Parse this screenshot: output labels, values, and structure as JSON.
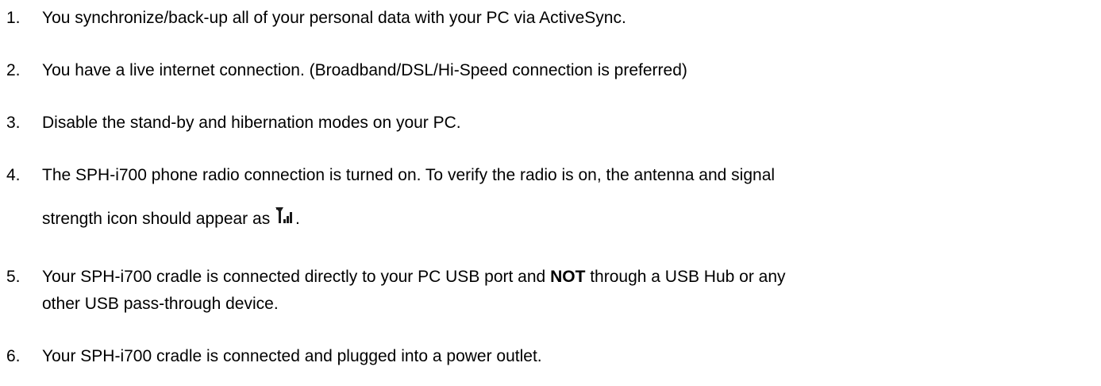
{
  "items": [
    {
      "num": "1.",
      "text": "You synchronize/back-up all of your personal data with your PC via ActiveSync."
    },
    {
      "num": "2.",
      "text": "You have a live internet connection. (Broadband/DSL/Hi-Speed connection is preferred)"
    },
    {
      "num": "3.",
      "text": "Disable the stand-by and hibernation modes on your PC."
    },
    {
      "num": "4.",
      "line1": "The SPH-i700 phone radio connection is turned on. To verify the radio is on, the antenna and signal",
      "line2_before": "strength icon should appear as",
      "line2_after": ".",
      "icon": "antenna-signal-icon"
    },
    {
      "num": "5.",
      "line1_before": "Your SPH-i700 cradle is connected directly to your PC USB port and ",
      "line1_bold": "NOT",
      "line1_after": " through a USB Hub or any",
      "line2": "other USB pass-through device."
    },
    {
      "num": "6.",
      "text": "Your SPH-i700 cradle is connected and plugged into a power outlet."
    }
  ]
}
